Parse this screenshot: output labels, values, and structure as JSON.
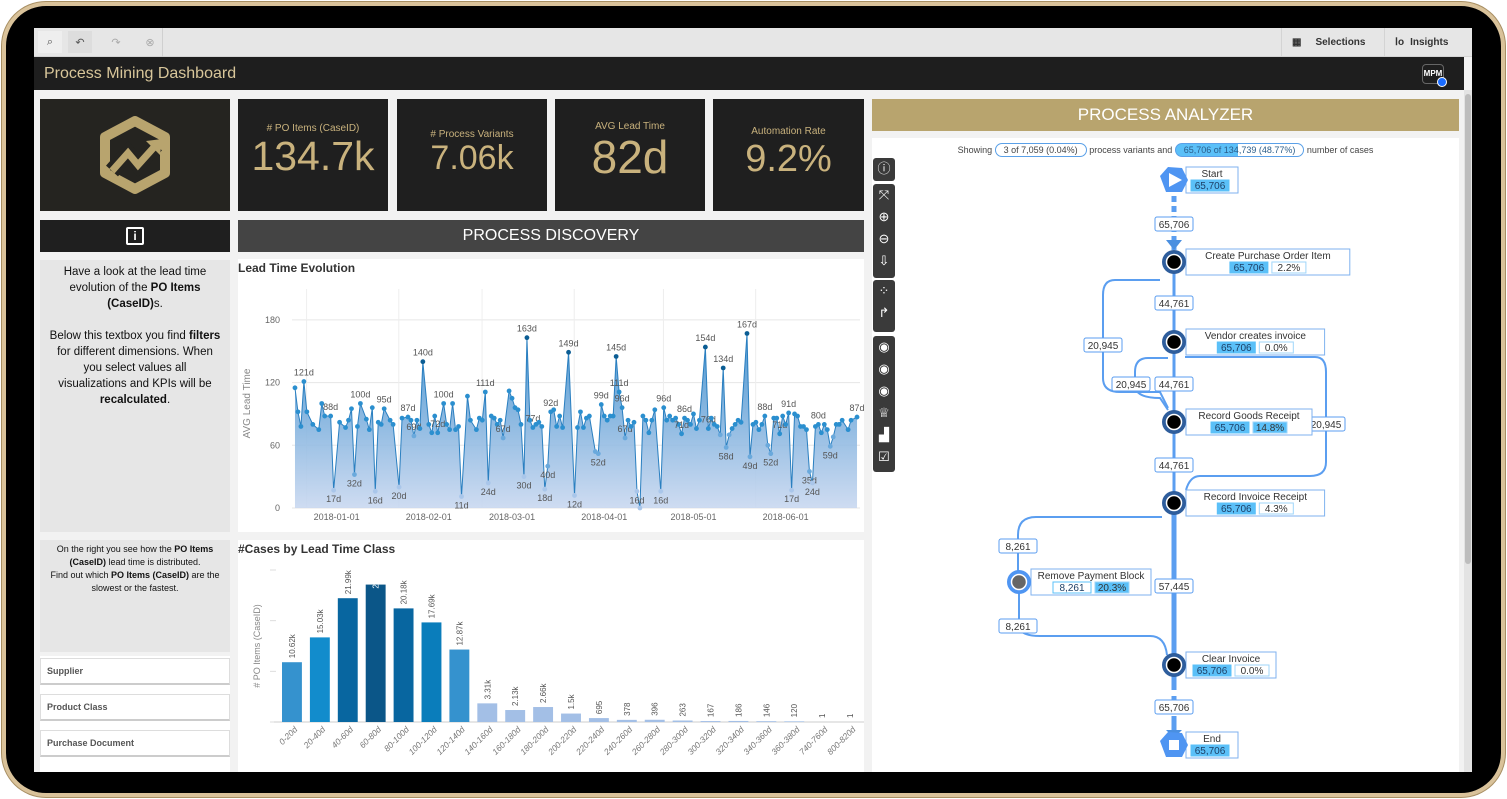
{
  "toolbar": {
    "icons": [
      "smart-search-icon",
      "step-back-icon",
      "step-forward-icon",
      "clear-selections-icon"
    ],
    "selections": "Selections",
    "insights": "Insights"
  },
  "app": {
    "title": "Process Mining Dashboard",
    "badge": "MPM"
  },
  "kpis": [
    {
      "label": "# PO Items (CaseID)",
      "value": "134.7k"
    },
    {
      "label": "# Process Variants",
      "value": "7.06k"
    },
    {
      "label": "AVG Lead Time",
      "value": "82d"
    },
    {
      "label": "Automation Rate",
      "value": "9.2%"
    }
  ],
  "colors": {
    "gold": "#b8a46e",
    "dark": "#1f1f1f",
    "accent_blue": "#4a8fe0",
    "highlight": "#5bc0f8"
  },
  "sections": {
    "discovery": "PROCESS DISCOVERY",
    "analyzer": "PROCESS ANALYZER"
  },
  "info1": {
    "pre": "Have a look at the lead time evolution of the ",
    "b1": "PO Items (CaseID)",
    "mid": "s.",
    "p2a": "Below this textbox you find ",
    "b2": "filters",
    "p2b": " for different dimensions. When you select values all visualizations and KPIs will be ",
    "b3": "recalculated",
    "p2c": "."
  },
  "info2": {
    "a": "On the right you see how the ",
    "b1": "PO Items (CaseID)",
    "c": " lead time is distributed.",
    "d": "Find out which ",
    "b2": "PO Items (CaseID)",
    "e": " are the slowest or the fastest."
  },
  "filters": [
    "Supplier",
    "Product Class",
    "Purchase Document"
  ],
  "chart_data": [
    {
      "type": "area",
      "title": "Lead Time Evolution",
      "ylabel": "AVG Lead Time",
      "xlabel": "",
      "ylim": [
        0,
        200
      ],
      "yticks": [
        0,
        60,
        120,
        180
      ],
      "grid": true,
      "xticks": [
        "2018-01-01",
        "2018-02-01",
        "2018-03-01",
        "2018-04-01",
        "2018-05-01",
        "2018-06-01"
      ],
      "xlim": [
        "2017-12-17",
        "2018-06-26"
      ],
      "value_suffix": "d",
      "points": [
        [
          "2017-12-18",
          115,
          0
        ],
        [
          "2017-12-19",
          92,
          0
        ],
        [
          "2017-12-20",
          78,
          0
        ],
        [
          "2017-12-21",
          121,
          1
        ],
        [
          "2017-12-22",
          92,
          0
        ],
        [
          "2017-12-24",
          80,
          0
        ],
        [
          "2017-12-26",
          75,
          0
        ],
        [
          "2017-12-27",
          100,
          0
        ],
        [
          "2017-12-28",
          88,
          0
        ],
        [
          "2017-12-30",
          88,
          1
        ],
        [
          "2017-12-31",
          17,
          1
        ],
        [
          "2018-01-02",
          82,
          0
        ],
        [
          "2018-01-04",
          77,
          0
        ],
        [
          "2018-01-05",
          84,
          0
        ],
        [
          "2018-01-06",
          95,
          0
        ],
        [
          "2018-01-07",
          32,
          1
        ],
        [
          "2018-01-08",
          78,
          0
        ],
        [
          "2018-01-09",
          100,
          1
        ],
        [
          "2018-01-11",
          85,
          0
        ],
        [
          "2018-01-12",
          75,
          0
        ],
        [
          "2018-01-13",
          96,
          0
        ],
        [
          "2018-01-14",
          16,
          1
        ],
        [
          "2018-01-15",
          82,
          0
        ],
        [
          "2018-01-16",
          80,
          0
        ],
        [
          "2018-01-17",
          95,
          1
        ],
        [
          "2018-01-19",
          84,
          0
        ],
        [
          "2018-01-20",
          80,
          0
        ],
        [
          "2018-01-22",
          20,
          1
        ],
        [
          "2018-01-23",
          86,
          0
        ],
        [
          "2018-01-25",
          87,
          1
        ],
        [
          "2018-01-26",
          84,
          0
        ],
        [
          "2018-01-27",
          69,
          1
        ],
        [
          "2018-01-28",
          84,
          0
        ],
        [
          "2018-01-29",
          76,
          0
        ],
        [
          "2018-01-30",
          140,
          1
        ],
        [
          "2018-02-01",
          80,
          0
        ],
        [
          "2018-02-02",
          72,
          0
        ],
        [
          "2018-02-03",
          88,
          0
        ],
        [
          "2018-02-04",
          72,
          1
        ],
        [
          "2018-02-06",
          100,
          1
        ],
        [
          "2018-02-07",
          80,
          0
        ],
        [
          "2018-02-08",
          75,
          0
        ],
        [
          "2018-02-09",
          100,
          0
        ],
        [
          "2018-02-10",
          75,
          0
        ],
        [
          "2018-02-11",
          78,
          0
        ],
        [
          "2018-02-12",
          11,
          1
        ],
        [
          "2018-02-14",
          107,
          0
        ],
        [
          "2018-02-15",
          84,
          0
        ],
        [
          "2018-02-17",
          75,
          0
        ],
        [
          "2018-02-18",
          86,
          0
        ],
        [
          "2018-02-19",
          84,
          0
        ],
        [
          "2018-02-20",
          111,
          1
        ],
        [
          "2018-02-21",
          24,
          1
        ],
        [
          "2018-02-22",
          88,
          0
        ],
        [
          "2018-02-23",
          86,
          0
        ],
        [
          "2018-02-24",
          80,
          0
        ],
        [
          "2018-02-25",
          84,
          0
        ],
        [
          "2018-02-26",
          67,
          1
        ],
        [
          "2018-02-28",
          112,
          0
        ],
        [
          "2018-03-01",
          105,
          0
        ],
        [
          "2018-03-02",
          96,
          0
        ],
        [
          "2018-03-03",
          94,
          0
        ],
        [
          "2018-03-04",
          80,
          0
        ],
        [
          "2018-03-05",
          30,
          1
        ],
        [
          "2018-03-06",
          163,
          1
        ],
        [
          "2018-03-07",
          84,
          0
        ],
        [
          "2018-03-08",
          77,
          1
        ],
        [
          "2018-03-09",
          80,
          0
        ],
        [
          "2018-03-10",
          82,
          0
        ],
        [
          "2018-03-11",
          78,
          0
        ],
        [
          "2018-03-12",
          18,
          1
        ],
        [
          "2018-03-13",
          40,
          1
        ],
        [
          "2018-03-14",
          92,
          1
        ],
        [
          "2018-03-15",
          94,
          0
        ],
        [
          "2018-03-16",
          78,
          0
        ],
        [
          "2018-03-17",
          88,
          0
        ],
        [
          "2018-03-18",
          77,
          0
        ],
        [
          "2018-03-20",
          149,
          1
        ],
        [
          "2018-03-22",
          12,
          1
        ],
        [
          "2018-03-23",
          77,
          0
        ],
        [
          "2018-03-24",
          92,
          0
        ],
        [
          "2018-03-25",
          77,
          0
        ],
        [
          "2018-03-26",
          86,
          0
        ],
        [
          "2018-03-27",
          88,
          0
        ],
        [
          "2018-03-29",
          54,
          0
        ],
        [
          "2018-03-30",
          52,
          1
        ],
        [
          "2018-03-31",
          99,
          1
        ],
        [
          "2018-04-01",
          88,
          0
        ],
        [
          "2018-04-02",
          84,
          0
        ],
        [
          "2018-04-03",
          88,
          0
        ],
        [
          "2018-04-04",
          88,
          0
        ],
        [
          "2018-04-05",
          145,
          1
        ],
        [
          "2018-04-06",
          111,
          1
        ],
        [
          "2018-04-07",
          96,
          1
        ],
        [
          "2018-04-08",
          67,
          1
        ],
        [
          "2018-04-09",
          84,
          0
        ],
        [
          "2018-04-10",
          78,
          0
        ],
        [
          "2018-04-11",
          82,
          0
        ],
        [
          "2018-04-12",
          16,
          1
        ],
        [
          "2018-04-13",
          0,
          0
        ],
        [
          "2018-04-14",
          88,
          0
        ],
        [
          "2018-04-15",
          84,
          0
        ],
        [
          "2018-04-16",
          72,
          0
        ],
        [
          "2018-04-17",
          84,
          0
        ],
        [
          "2018-04-18",
          94,
          0
        ],
        [
          "2018-04-20",
          16,
          1
        ],
        [
          "2018-04-21",
          96,
          1
        ],
        [
          "2018-04-22",
          84,
          0
        ],
        [
          "2018-04-23",
          88,
          0
        ],
        [
          "2018-04-24",
          84,
          0
        ],
        [
          "2018-04-25",
          86,
          0
        ],
        [
          "2018-04-26",
          80,
          0
        ],
        [
          "2018-04-27",
          71,
          1
        ],
        [
          "2018-04-28",
          86,
          1
        ],
        [
          "2018-04-29",
          84,
          0
        ],
        [
          "2018-04-30",
          80,
          0
        ],
        [
          "2018-05-01",
          90,
          0
        ],
        [
          "2018-05-02",
          76,
          0
        ],
        [
          "2018-05-03",
          84,
          0
        ],
        [
          "2018-05-05",
          154,
          1
        ],
        [
          "2018-05-06",
          76,
          1
        ],
        [
          "2018-05-07",
          86,
          0
        ],
        [
          "2018-05-08",
          80,
          0
        ],
        [
          "2018-05-09",
          78,
          0
        ],
        [
          "2018-05-10",
          70,
          0
        ],
        [
          "2018-05-11",
          134,
          1
        ],
        [
          "2018-05-12",
          58,
          1
        ],
        [
          "2018-05-13",
          70,
          0
        ],
        [
          "2018-05-14",
          76,
          0
        ],
        [
          "2018-05-15",
          80,
          0
        ],
        [
          "2018-05-16",
          84,
          0
        ],
        [
          "2018-05-17",
          82,
          0
        ],
        [
          "2018-05-19",
          167,
          1
        ],
        [
          "2018-05-20",
          49,
          1
        ],
        [
          "2018-05-21",
          80,
          0
        ],
        [
          "2018-05-22",
          82,
          0
        ],
        [
          "2018-05-23",
          75,
          0
        ],
        [
          "2018-05-24",
          80,
          0
        ],
        [
          "2018-05-25",
          88,
          1
        ],
        [
          "2018-05-26",
          60,
          0
        ],
        [
          "2018-05-27",
          52,
          1
        ],
        [
          "2018-05-28",
          86,
          0
        ],
        [
          "2018-05-29",
          86,
          0
        ],
        [
          "2018-05-30",
          71,
          1
        ],
        [
          "2018-05-31",
          88,
          0
        ],
        [
          "2018-06-01",
          80,
          0
        ],
        [
          "2018-06-02",
          91,
          1
        ],
        [
          "2018-06-03",
          17,
          1
        ],
        [
          "2018-06-04",
          90,
          0
        ],
        [
          "2018-06-05",
          88,
          0
        ],
        [
          "2018-06-06",
          78,
          0
        ],
        [
          "2018-06-07",
          78,
          0
        ],
        [
          "2018-06-08",
          75,
          0
        ],
        [
          "2018-06-09",
          35,
          1
        ],
        [
          "2018-06-10",
          24,
          1
        ],
        [
          "2018-06-11",
          78,
          0
        ],
        [
          "2018-06-12",
          80,
          1
        ],
        [
          "2018-06-13",
          72,
          0
        ],
        [
          "2018-06-14",
          80,
          0
        ],
        [
          "2018-06-15",
          75,
          0
        ],
        [
          "2018-06-16",
          59,
          1
        ],
        [
          "2018-06-17",
          68,
          0
        ],
        [
          "2018-06-18",
          80,
          0
        ],
        [
          "2018-06-19",
          80,
          0
        ],
        [
          "2018-06-20",
          84,
          0
        ],
        [
          "2018-06-22",
          75,
          0
        ],
        [
          "2018-06-23",
          84,
          0
        ],
        [
          "2018-06-25",
          87,
          1
        ]
      ]
    },
    {
      "type": "bar",
      "title": "#Cases by Lead Time Class",
      "ylabel": "# PO Items (CaseID)",
      "xlabel": "",
      "ylim": [
        0,
        27000
      ],
      "categories": [
        "0-20d",
        "20-40d",
        "40-60d",
        "60-80d",
        "80-100d",
        "100-120d",
        "120-140d",
        "140-160d",
        "160-180d",
        "180-200d",
        "200-220d",
        "220-240d",
        "240-260d",
        "260-280d",
        "280-300d",
        "300-320d",
        "320-340d",
        "340-360d",
        "360-380d",
        "740-760d",
        "800-820d"
      ],
      "values": [
        10620,
        15030,
        21990,
        24410,
        20180,
        17690,
        12870,
        3310,
        2130,
        2660,
        1500,
        695,
        378,
        396,
        263,
        167,
        186,
        146,
        120,
        1,
        1
      ],
      "labels": [
        "10.62k",
        "15.03k",
        "21.99k",
        "24.41k",
        "20.18k",
        "17.69k",
        "12.87k",
        "3.31k",
        "2.13k",
        "2.66k",
        "1.5k",
        "695",
        "378",
        "396",
        "263",
        "167",
        "186",
        "146",
        "120",
        "1",
        "1"
      ]
    }
  ],
  "analyzer": {
    "showing": "Showing",
    "variants": "3 of 7,059 (0.04%)",
    "mid": "process variants and",
    "cases": "65,706 of 134,739 (48.77%)",
    "end": "number of cases",
    "variants_fraction": 0.0004,
    "cases_fraction": 0.4877,
    "tools": [
      "info-icon",
      "fit-icon",
      "zoom-in-icon",
      "zoom-out-icon",
      "download-png-icon",
      "nodes-icon",
      "path-icon",
      "add-view-icon",
      "remove-view-icon",
      "view-settings-icon",
      "trophy-icon",
      "podium-icon",
      "checkbox-icon"
    ],
    "nodes": [
      {
        "name": "Start",
        "count": "65,706"
      },
      {
        "name": "Create Purchase Order Item",
        "count": "65,706",
        "pct": "2.2%"
      },
      {
        "name": "Vendor creates invoice",
        "count": "65,706",
        "pct": "0.0%"
      },
      {
        "name": "Record Goods Receipt",
        "count": "65,706",
        "pct": "14.8%"
      },
      {
        "name": "Record Invoice Receipt",
        "count": "65,706",
        "pct": "4.3%"
      },
      {
        "name": "Remove Payment Block",
        "count": "8,261",
        "pct": "20.3%"
      },
      {
        "name": "Clear Invoice",
        "count": "65,706",
        "pct": "0.0%"
      },
      {
        "name": "End",
        "count": "65,706"
      }
    ],
    "edges": [
      "65,706",
      "44,761",
      "20,945",
      "20,945",
      "44,761",
      "20,945",
      "44,761",
      "8,261",
      "57,445",
      "8,261",
      "65,706"
    ]
  }
}
